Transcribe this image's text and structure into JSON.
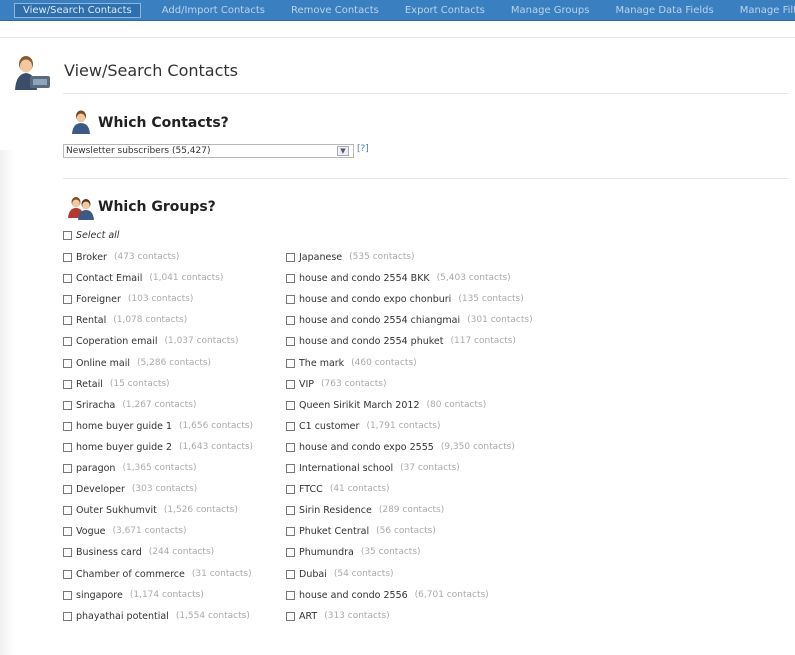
{
  "nav": {
    "items": [
      {
        "label": "View/Search Contacts",
        "active": true
      },
      {
        "label": "Add/Import Contacts",
        "active": false
      },
      {
        "label": "Remove Contacts",
        "active": false
      },
      {
        "label": "Export Contacts",
        "active": false
      },
      {
        "label": "Manage Groups",
        "active": false
      },
      {
        "label": "Manage Data Fields",
        "active": false
      },
      {
        "label": "Manage Filters",
        "active": false
      }
    ]
  },
  "page": {
    "title": "View/Search Contacts"
  },
  "which_contacts": {
    "title": "Which Contacts?",
    "selected": "Newsletter subscribers (55,427)",
    "help": "[?]"
  },
  "which_groups": {
    "title": "Which Groups?",
    "select_all": "Select all",
    "left": [
      {
        "name": "Broker",
        "count": "(473 contacts)"
      },
      {
        "name": "Contact Email",
        "count": "(1,041 contacts)"
      },
      {
        "name": "Foreigner",
        "count": "(103 contacts)"
      },
      {
        "name": "Rental",
        "count": "(1,078 contacts)"
      },
      {
        "name": "Coperation email",
        "count": "(1,037 contacts)"
      },
      {
        "name": "Online mail",
        "count": "(5,286 contacts)"
      },
      {
        "name": "Retail",
        "count": "(15 contacts)"
      },
      {
        "name": "Sriracha",
        "count": "(1,267 contacts)"
      },
      {
        "name": "home buyer guide 1",
        "count": "(1,656 contacts)"
      },
      {
        "name": "home buyer guide 2",
        "count": "(1,643 contacts)"
      },
      {
        "name": "paragon",
        "count": "(1,365 contacts)"
      },
      {
        "name": "Developer",
        "count": "(303 contacts)"
      },
      {
        "name": "Outer Sukhumvit",
        "count": "(1,526 contacts)"
      },
      {
        "name": "Vogue",
        "count": "(3,671 contacts)"
      },
      {
        "name": "Business card",
        "count": "(244 contacts)"
      },
      {
        "name": "Chamber of commerce",
        "count": "(31 contacts)"
      },
      {
        "name": "singapore",
        "count": "(1,174 contacts)"
      },
      {
        "name": "phayathai potential",
        "count": "(1,554 contacts)"
      }
    ],
    "right": [
      {
        "name": "Japanese",
        "count": "(535 contacts)"
      },
      {
        "name": "house and condo 2554 BKK",
        "count": "(5,403 contacts)"
      },
      {
        "name": "house and condo expo chonburi",
        "count": "(135 contacts)"
      },
      {
        "name": "house and condo 2554 chiangmai",
        "count": "(301 contacts)"
      },
      {
        "name": "house and condo 2554 phuket",
        "count": "(117 contacts)"
      },
      {
        "name": "The mark",
        "count": "(460 contacts)"
      },
      {
        "name": "VIP",
        "count": "(763 contacts)"
      },
      {
        "name": "Queen Sirikit March 2012",
        "count": "(80 contacts)"
      },
      {
        "name": "C1 customer",
        "count": "(1,791 contacts)"
      },
      {
        "name": "house and condo expo 2555",
        "count": "(9,350 contacts)"
      },
      {
        "name": "International school",
        "count": "(37 contacts)"
      },
      {
        "name": "FTCC",
        "count": "(41 contacts)"
      },
      {
        "name": "Sirin Residence",
        "count": "(289 contacts)"
      },
      {
        "name": "Phuket Central",
        "count": "(56 contacts)"
      },
      {
        "name": "Phumundra",
        "count": "(35 contacts)"
      },
      {
        "name": "Dubai",
        "count": "(54 contacts)"
      },
      {
        "name": "house and condo 2556",
        "count": "(6,701 contacts)"
      },
      {
        "name": "ART",
        "count": "(313 contacts)"
      }
    ]
  }
}
